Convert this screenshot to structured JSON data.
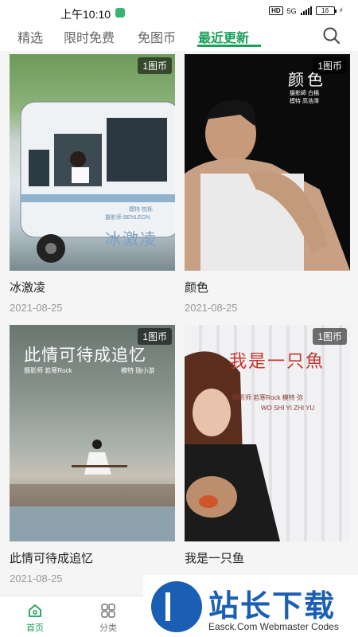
{
  "status_bar": {
    "time": "上午10:10",
    "network": "5G",
    "battery": "16"
  },
  "tabs": [
    {
      "label": "精选"
    },
    {
      "label": "限时免费"
    },
    {
      "label": "免图币"
    },
    {
      "label": "最近更新"
    }
  ],
  "cards": [
    {
      "badge": "1图币",
      "title": "冰激凌",
      "date": "2021-08-25",
      "cover_text": {
        "title": "冰激凌",
        "credit": "摄影师 BENLEON",
        "credit2": "模特 枕栎"
      }
    },
    {
      "badge": "1图币",
      "title": "颜色",
      "date": "2021-08-25",
      "cover_text": {
        "title": "颜色",
        "credit": "摄影師 白楊",
        "credit2": "模特 高浩澤"
      }
    },
    {
      "badge": "1图币",
      "title": "此情可待成追忆",
      "date": "2021-08-25",
      "cover_text": {
        "title": "此情可待成追忆",
        "credit": "摄影师 若寒Rock",
        "credit2": "模特 瑞小游"
      }
    },
    {
      "badge": "1图币",
      "title": "我是一只鱼",
      "date": "2021-08-25",
      "cover_text": {
        "title": "我是一只魚",
        "credit": "摄影师 若寒Rock  模特 弥",
        "credit2": "WO SHI YI ZHI YU"
      }
    }
  ],
  "bottom_nav": [
    {
      "label": "首页",
      "icon": "home-icon"
    },
    {
      "label": "分类",
      "icon": "grid-icon"
    }
  ],
  "watermark": {
    "title": "站长下载",
    "subtitle": "Easck.Com Webmaster Codes"
  },
  "colors": {
    "accent": "#1aa05a",
    "watermark": "#1a5fb4"
  }
}
